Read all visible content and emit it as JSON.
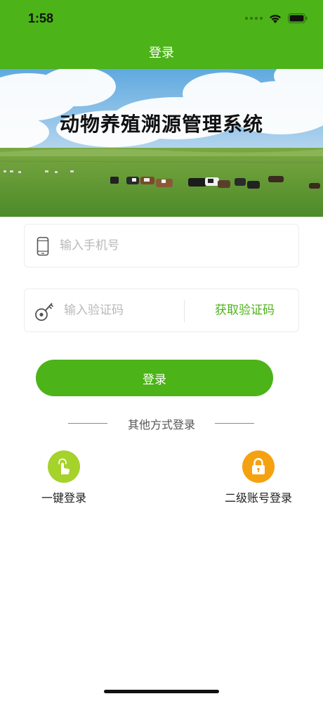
{
  "status_bar": {
    "time": "1:58"
  },
  "nav": {
    "title": "登录"
  },
  "banner": {
    "title": "动物养殖溯源管理系统"
  },
  "form": {
    "phone": {
      "value": "",
      "placeholder": "输入手机号"
    },
    "code": {
      "value": "",
      "placeholder": "输入验证码"
    },
    "get_code_label": "获取验证码",
    "login_label": "登录"
  },
  "other_login": {
    "divider_text": "其他方式登录",
    "options": [
      {
        "label": "一键登录",
        "icon": "touch-icon",
        "color": "#a6d22c"
      },
      {
        "label": "二级账号登录",
        "icon": "lock-icon",
        "color": "#f5a211"
      }
    ]
  },
  "colors": {
    "primary": "#4cb318"
  }
}
